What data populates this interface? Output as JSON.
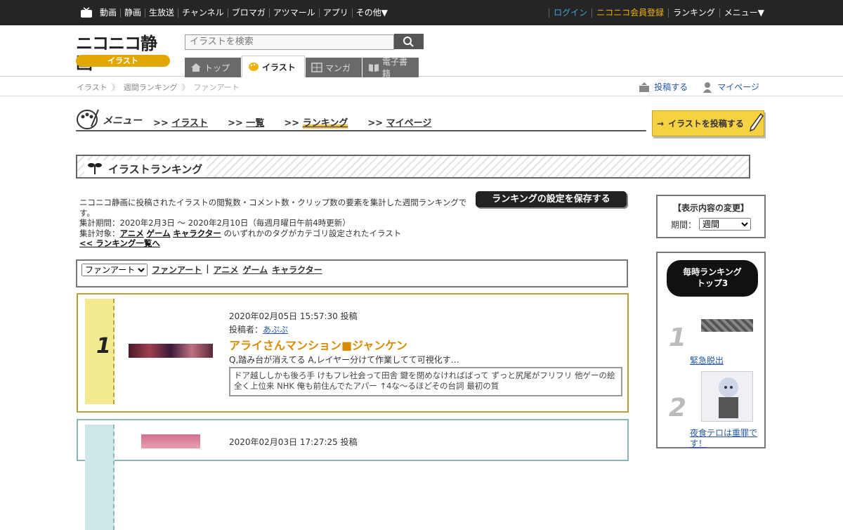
{
  "topbar": {
    "nav": [
      "動画",
      "静画",
      "生放送",
      "チャンネル",
      "ブロマガ",
      "アツマール",
      "アプリ",
      "その他▼"
    ],
    "login": "ログイン",
    "register": "ニコニコ会員登録",
    "ranking": "ランキング",
    "menu": "メニュー▼"
  },
  "header": {
    "logo_text": "ニコニコ静画",
    "logo_sub": "イラスト",
    "search_placeholder": "イラストを検索",
    "tabs": [
      {
        "label": "トップ",
        "icon": "home-icon"
      },
      {
        "label": "イラスト",
        "icon": "palette-icon"
      },
      {
        "label": "マンガ",
        "icon": "manga-icon"
      },
      {
        "label": "電子書籍",
        "icon": "book-icon"
      }
    ]
  },
  "breadcrumb": {
    "items": [
      "イラスト",
      "週間ランキング",
      "ファンアート"
    ],
    "post_link": "投稿する",
    "mypage_link": "マイページ"
  },
  "menu": {
    "label": "メニュー",
    "links": [
      "イラスト",
      "一覧",
      "ランキング",
      "マイページ"
    ],
    "post_button": "イラストを投稿する"
  },
  "page": {
    "title": "イラストランキング",
    "description": "ニコニコ静画に投稿されたイラストの閲覧数・コメント数・クリップ数の要素を集計した週間ランキングです。",
    "period_label": "集計期間：",
    "period_value": "2020年2月3日 ～ 2020年2月10日（毎週月曜日午前4時更新）",
    "target_label": "集計対象：",
    "target_tags": [
      "アニメ",
      "ゲーム",
      "キャラクター"
    ],
    "target_suffix": "のいずれかのタグがカテゴリ設定されたイラスト",
    "back_link": "<< ランキング一覧へ",
    "save_button": "ランキングの設定を保存する"
  },
  "filter": {
    "selected": "ファンアート",
    "links": [
      "ファンアート",
      "アニメ",
      "ゲーム",
      "キャラクター"
    ],
    "separator": "|"
  },
  "ranks": [
    {
      "rank": "1",
      "date": "2020年02月05日 15:57:30 投稿",
      "poster_label": "投稿者：",
      "poster": "あぷぷ",
      "title": "アライさんマンション■ジャンケン",
      "intro": "Q,踏み台が消えてる A,レイヤー分けて作業してて可視化す…",
      "comments": "ドア越ししかも後ろ手 けもフレ社会って田舎 鍵を閉めなければばって ずっと尻尾がフリフリ 他ゲーの絵全く上位来 NHK 俺も前住んでたアパー ↑4な～るほどその台詞 最初の質"
    },
    {
      "rank": "2",
      "date": "2020年02月03日 17:27:25 投稿"
    }
  ],
  "sidebar": {
    "settings_title": "【表示内容の変更】",
    "period_label": "期間：",
    "period_value": "週間",
    "top3_title": "毎時ランキング\nトップ3",
    "top3": [
      {
        "rank": "1",
        "title": "緊急脱出"
      },
      {
        "rank": "2",
        "title": "夜食テロは重罪です！"
      }
    ]
  }
}
